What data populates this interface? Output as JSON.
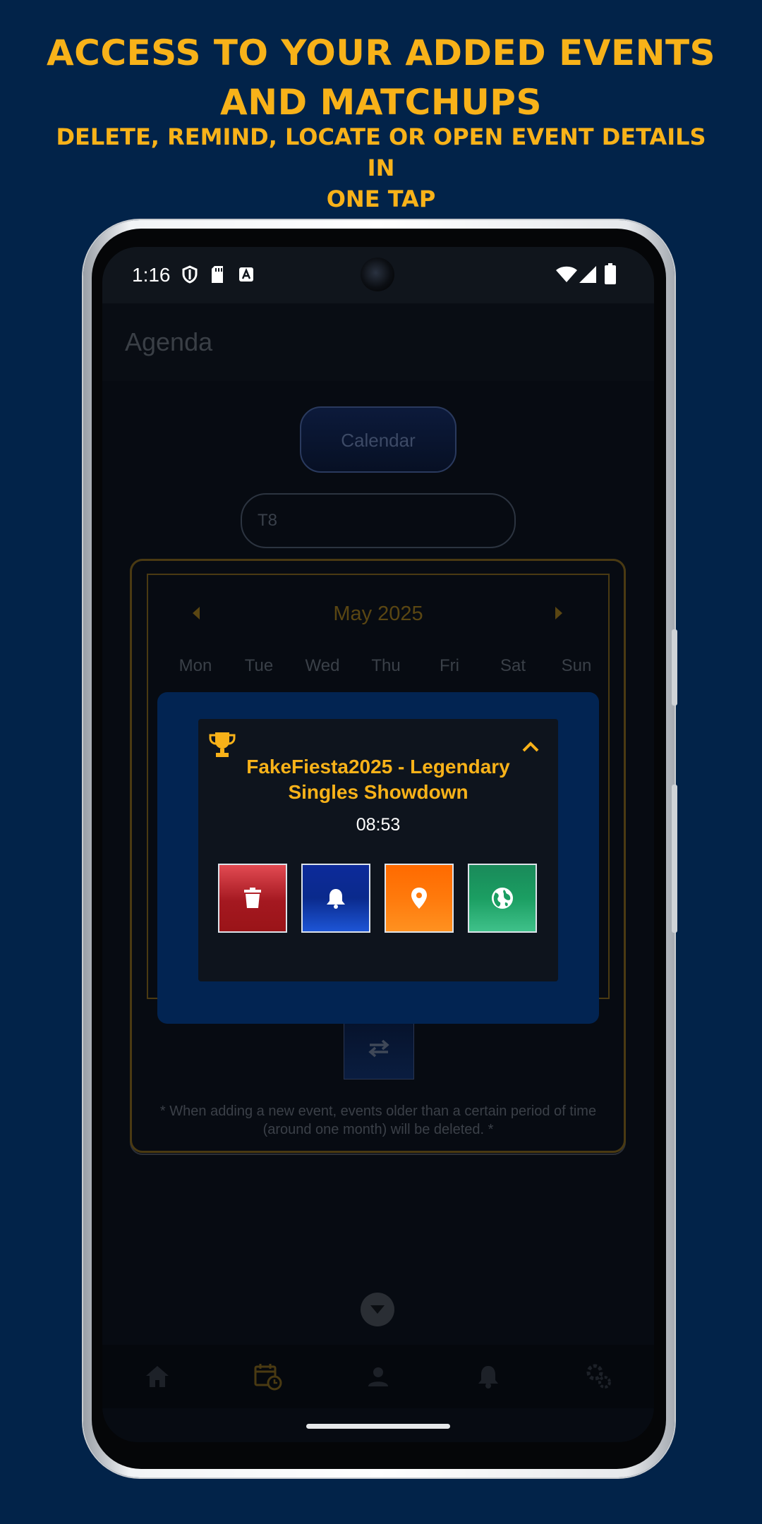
{
  "promo": {
    "headline_line1": "ACCESS TO YOUR ADDED EVENTS",
    "headline_line2": "AND MATCHUPS",
    "subline_line1": "DELETE, REMIND, LOCATE OR OPEN EVENT DETAILS IN",
    "subline_line2": "ONE TAP"
  },
  "statusbar": {
    "time": "1:16",
    "left_icons": [
      "shield-icon",
      "sd-card-icon",
      "font-a-icon"
    ],
    "right_icons": [
      "wifi-icon",
      "cell-signal-icon",
      "battery-icon"
    ]
  },
  "appbar": {
    "title": "Agenda"
  },
  "toolbar": {
    "calendar_label": "Calendar",
    "filter_value": "T8"
  },
  "calendar": {
    "month": "May 2025",
    "weekdays": [
      "Mon",
      "Tue",
      "Wed",
      "Thu",
      "Fri",
      "Sat",
      "Sun"
    ]
  },
  "event_popup": {
    "icon": "trophy-icon",
    "title": "FakeFiesta2025 - Legendary Singles Showdown",
    "time": "08:53",
    "actions": [
      {
        "name": "delete",
        "icon": "trash-icon",
        "color": "#a41820"
      },
      {
        "name": "remind",
        "icon": "bell-icon",
        "color": "#0a2a8c"
      },
      {
        "name": "locate",
        "icon": "location-pin-icon",
        "color": "#ff7a0c"
      },
      {
        "name": "open-details",
        "icon": "globe-icon",
        "color": "#1b9e62"
      }
    ]
  },
  "note": "* When adding a new event, events older than a certain period of time (around one month) will be deleted. *",
  "bottom_nav": [
    "home-icon",
    "calendar-clock-icon",
    "person-icon",
    "bell-icon",
    "settings-icon"
  ],
  "colors": {
    "background": "#022349",
    "accent": "#f8b219",
    "modal": "#022452",
    "popup": "#0e141d"
  }
}
